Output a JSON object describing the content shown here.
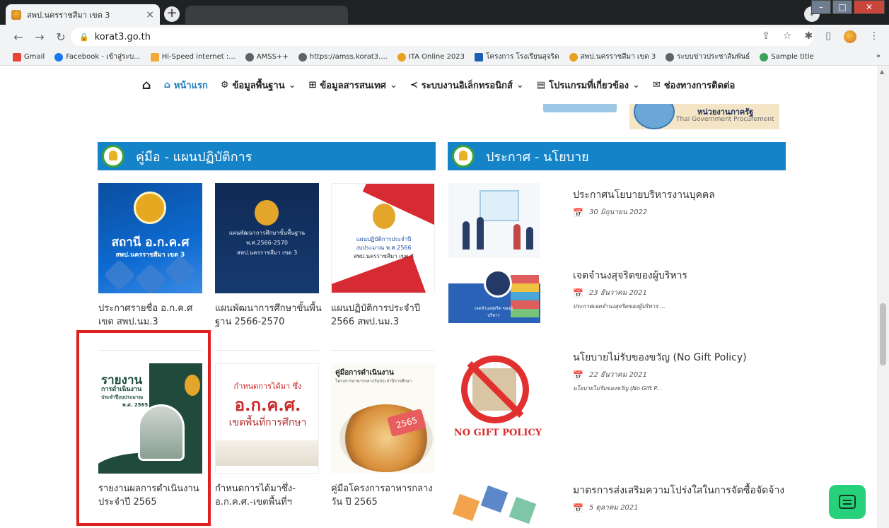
{
  "browser": {
    "tab_title": "สพป.นครราชสีมา เขต 3",
    "tab_close": "×",
    "new_tab": "+",
    "url": "korat3.go.th"
  },
  "bookmarks": [
    {
      "label": "Gmail",
      "color": "#ea4335"
    },
    {
      "label": "Facebook - เข้าสู่ระบ...",
      "color": "#1877f2"
    },
    {
      "label": "Hi-Speed internet :...",
      "color": "#f2a93b"
    },
    {
      "label": "AMSS++",
      "color": "#5f6368"
    },
    {
      "label": "https://amss.korat3....",
      "color": "#5f6368"
    },
    {
      "label": "ITA Online 2023",
      "color": "#e8a020"
    },
    {
      "label": "โครงการ โรงเรียนสุจริต",
      "color": "#1a5fb4"
    },
    {
      "label": "สพป.นครราชสีมา เขต 3",
      "color": "#e8a020"
    },
    {
      "label": "ระบบข่าวประชาสัมพันธ์",
      "color": "#5f6368"
    },
    {
      "label": "Sample title",
      "color": "#3aa35b"
    }
  ],
  "nav": {
    "home": "หน้าแรก",
    "basic_info": "ข้อมูลพื้นฐาน",
    "it_info": "ข้อมูลสารสนเทศ",
    "e_systems": "ระบบงานอิเล็กทรอนิกส์",
    "programs": "โปรแกรมที่เกี่ยวข้อง",
    "contact": "ช่องทางการติดต่อ"
  },
  "gov_banner": {
    "title": "หน่วยงานภาครัฐ",
    "subtitle": "Thai Government Procurement"
  },
  "sections": {
    "manuals_title": "คู่มือ - แผนปฏิบัติการ",
    "announce_title": "ประกาศ - นโยบาย"
  },
  "manuals": [
    {
      "title": "ประกาศรายชื่อ อ.ก.ค.ศ เขต สพป.นม.3",
      "thumb_big": "สถานี อ.ก.ค.ศ",
      "thumb_small": "สพป.นครราชสีมา เขต 3"
    },
    {
      "title": "แผนพัฒนาการศึกษาขั้นพื้นฐาน 2566-2570",
      "thumb_l1": "แผนพัฒนาการศึกษาขั้นพื้นฐาน",
      "thumb_l2": "พ.ศ.2566-2570",
      "thumb_l3": "สพป.นครราชสีมา เขต 3"
    },
    {
      "title": "แผนปฏิบัติการประจำปี 2566 สพป.นม.3",
      "thumb_l1": "แผนปฏิบัติการประจำปี",
      "thumb_l2": "งบประมาณ พ.ศ.2566",
      "thumb_l3": "สพป.นครราชสีมา เขต 3"
    },
    {
      "title": "รายงานผลการดำเนินงานประจำปี 2565",
      "thumb_h1": "รายงาน",
      "thumb_h2": "การดำเนินงาน",
      "thumb_h3": "ประจำปีงบประมาณ",
      "thumb_h4": "พ.ศ. 2565"
    },
    {
      "title": "กำหนดการได้มาซึ่ง-อ.ก.ค.ศ.-เขตพื้นที่ฯ",
      "thumb_t1": "กำหนดการได้มา ซึ่ง",
      "thumb_t2": "อ.ก.ค.ศ.",
      "thumb_t3": "เขตพื้นที่การศึกษา"
    },
    {
      "title": "คู่มือโครงการอาหารกลางวัน ปี 2565",
      "thumb_hd": "คู่มือการดำเนินงาน",
      "thumb_sub": "โครงการอาหารกลางวันประจำปีการศึกษา",
      "thumb_tag": "2565"
    }
  ],
  "announcements": [
    {
      "title": "ประกาศนโยบายบริหารงานบุคคล",
      "date": "30 มิถุนายน 2022",
      "excerpt": ""
    },
    {
      "title": "เจตจำนงสุจริตของผู้บริหาร",
      "date": "23 ธันวาคม 2021",
      "excerpt": "ประกาศเจตจำนงสุจริตของผู้บริหาร ..."
    },
    {
      "title": "นโยบายไม่รับของขวัญ (No Gift Policy)",
      "date": "22 ธันวาคม 2021",
      "excerpt": "นโยบายไม่รับของขวัญ (No Gift P..."
    },
    {
      "title": "มาตรการส่งเสริมความโปร่งใสในการจัดซื้อจัดจ้าง",
      "date": "5 ตุลาคม 2021",
      "excerpt": ""
    }
  ],
  "news_thumb_text": {
    "integrity": "เจตจำนงสุจริต ของผู้บริหาร",
    "no_gift": "NO GIFT POLICY"
  }
}
